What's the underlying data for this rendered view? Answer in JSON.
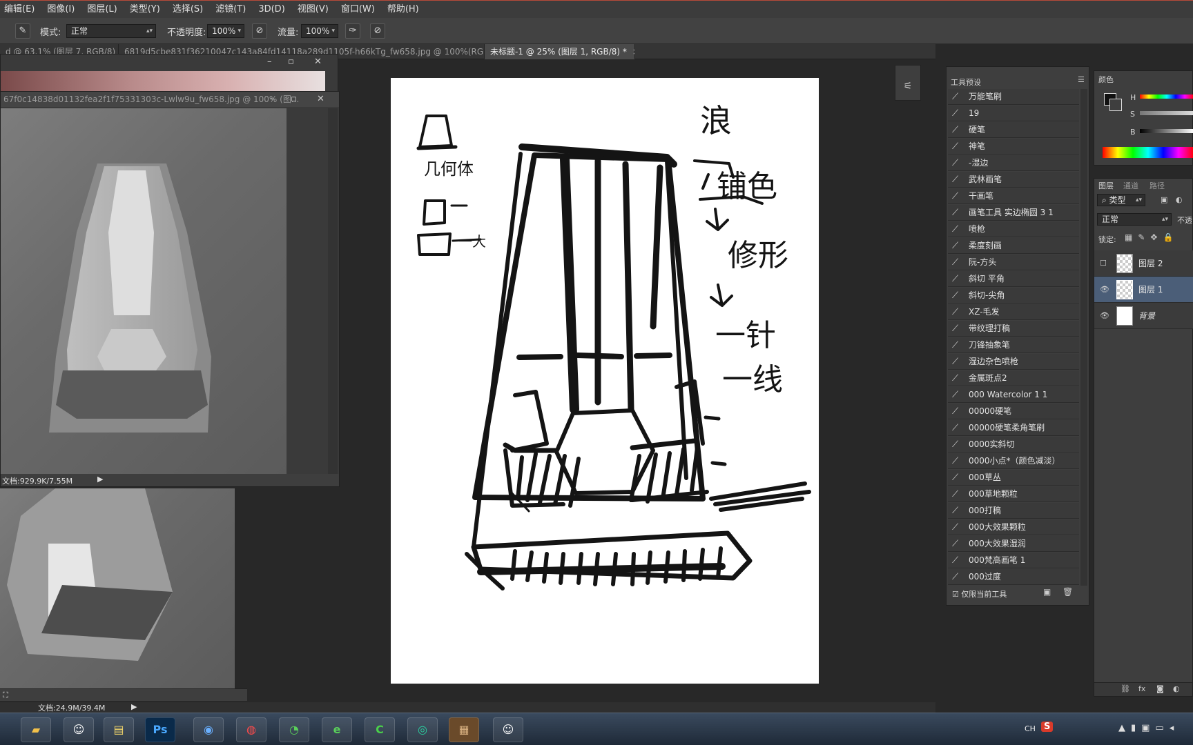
{
  "menu": [
    "编辑(E)",
    "图像(I)",
    "图层(L)",
    "类型(Y)",
    "选择(S)",
    "滤镜(T)",
    "3D(D)",
    "视图(V)",
    "窗口(W)",
    "帮助(H)"
  ],
  "options": {
    "mode_label": "模式:",
    "mode_value": "正常",
    "opacity_label": "不透明度:",
    "opacity_value": "100%",
    "flow_label": "流量:",
    "flow_value": "100%"
  },
  "tabs": [
    {
      "label": "d @ 63.1% (图层 7, RGB/8) *",
      "active": false
    },
    {
      "label": "6819d5cbe831f36210047c143a84fd14118a289d1105f-h66kTg_fw658.jpg @ 100%(RGB/8)",
      "active": false
    },
    {
      "label": "未标题-1 @ 25% (图层 1, RGB/8) *",
      "active": true
    }
  ],
  "ref_window": {
    "title": "67f0c14838d01132fea2f1f75331303c-Lwlw9u_fw658.jpg @ 100% (图...",
    "status": "文档:929.9K/7.55M"
  },
  "main_status": "文档:24.9M/39.4M",
  "canvas_notes": {
    "left_top": "几何体",
    "left_mid": "一大",
    "right_1": "浪",
    "right_2": "铺色",
    "right_3": "修形",
    "right_4": "一针",
    "right_5": "一线"
  },
  "presets_panel": {
    "title": "工具预设",
    "items": [
      "万能笔刷",
      "19",
      "硬笔",
      "神笔",
      "-湿边",
      "武林画笔",
      "干画笔",
      "画笔工具 实边椭圆 3 1",
      "喷枪",
      "柔度刻画",
      "阮-方头",
      "斜切 平角",
      "斜切-尖角",
      "XZ-毛发",
      "带纹理打稿",
      "刀锋抽象笔",
      "湿边杂色喷枪",
      "金属斑点2",
      "000 Watercolor 1 1",
      "00000硬笔",
      "00000硬笔柔角笔刷",
      "0000实斜切",
      "0000小点*（颜色减淡）",
      "000草丛",
      "000草地颗粒",
      "000打稿",
      "000大效果颗粒",
      "000大效果湿润",
      "000梵高画笔 1",
      "000过度"
    ],
    "footer_check": "仅限当前工具"
  },
  "color_panel": {
    "title": "颜色",
    "h": "H",
    "s": "S",
    "b": "B"
  },
  "layers_panel": {
    "tabs": [
      "图层",
      "通道",
      "路径"
    ],
    "filter": "类型",
    "blend": "正常",
    "opacity_short": "不透",
    "lock_label": "锁定:",
    "layers": [
      {
        "name": "图层 2",
        "visible": false,
        "selected": false
      },
      {
        "name": "图层 1",
        "visible": true,
        "selected": true
      },
      {
        "name": "背景",
        "visible": true,
        "selected": false
      }
    ]
  },
  "tray": {
    "ime": "CH",
    "sogou": "S"
  },
  "accent": "#4b5e78"
}
